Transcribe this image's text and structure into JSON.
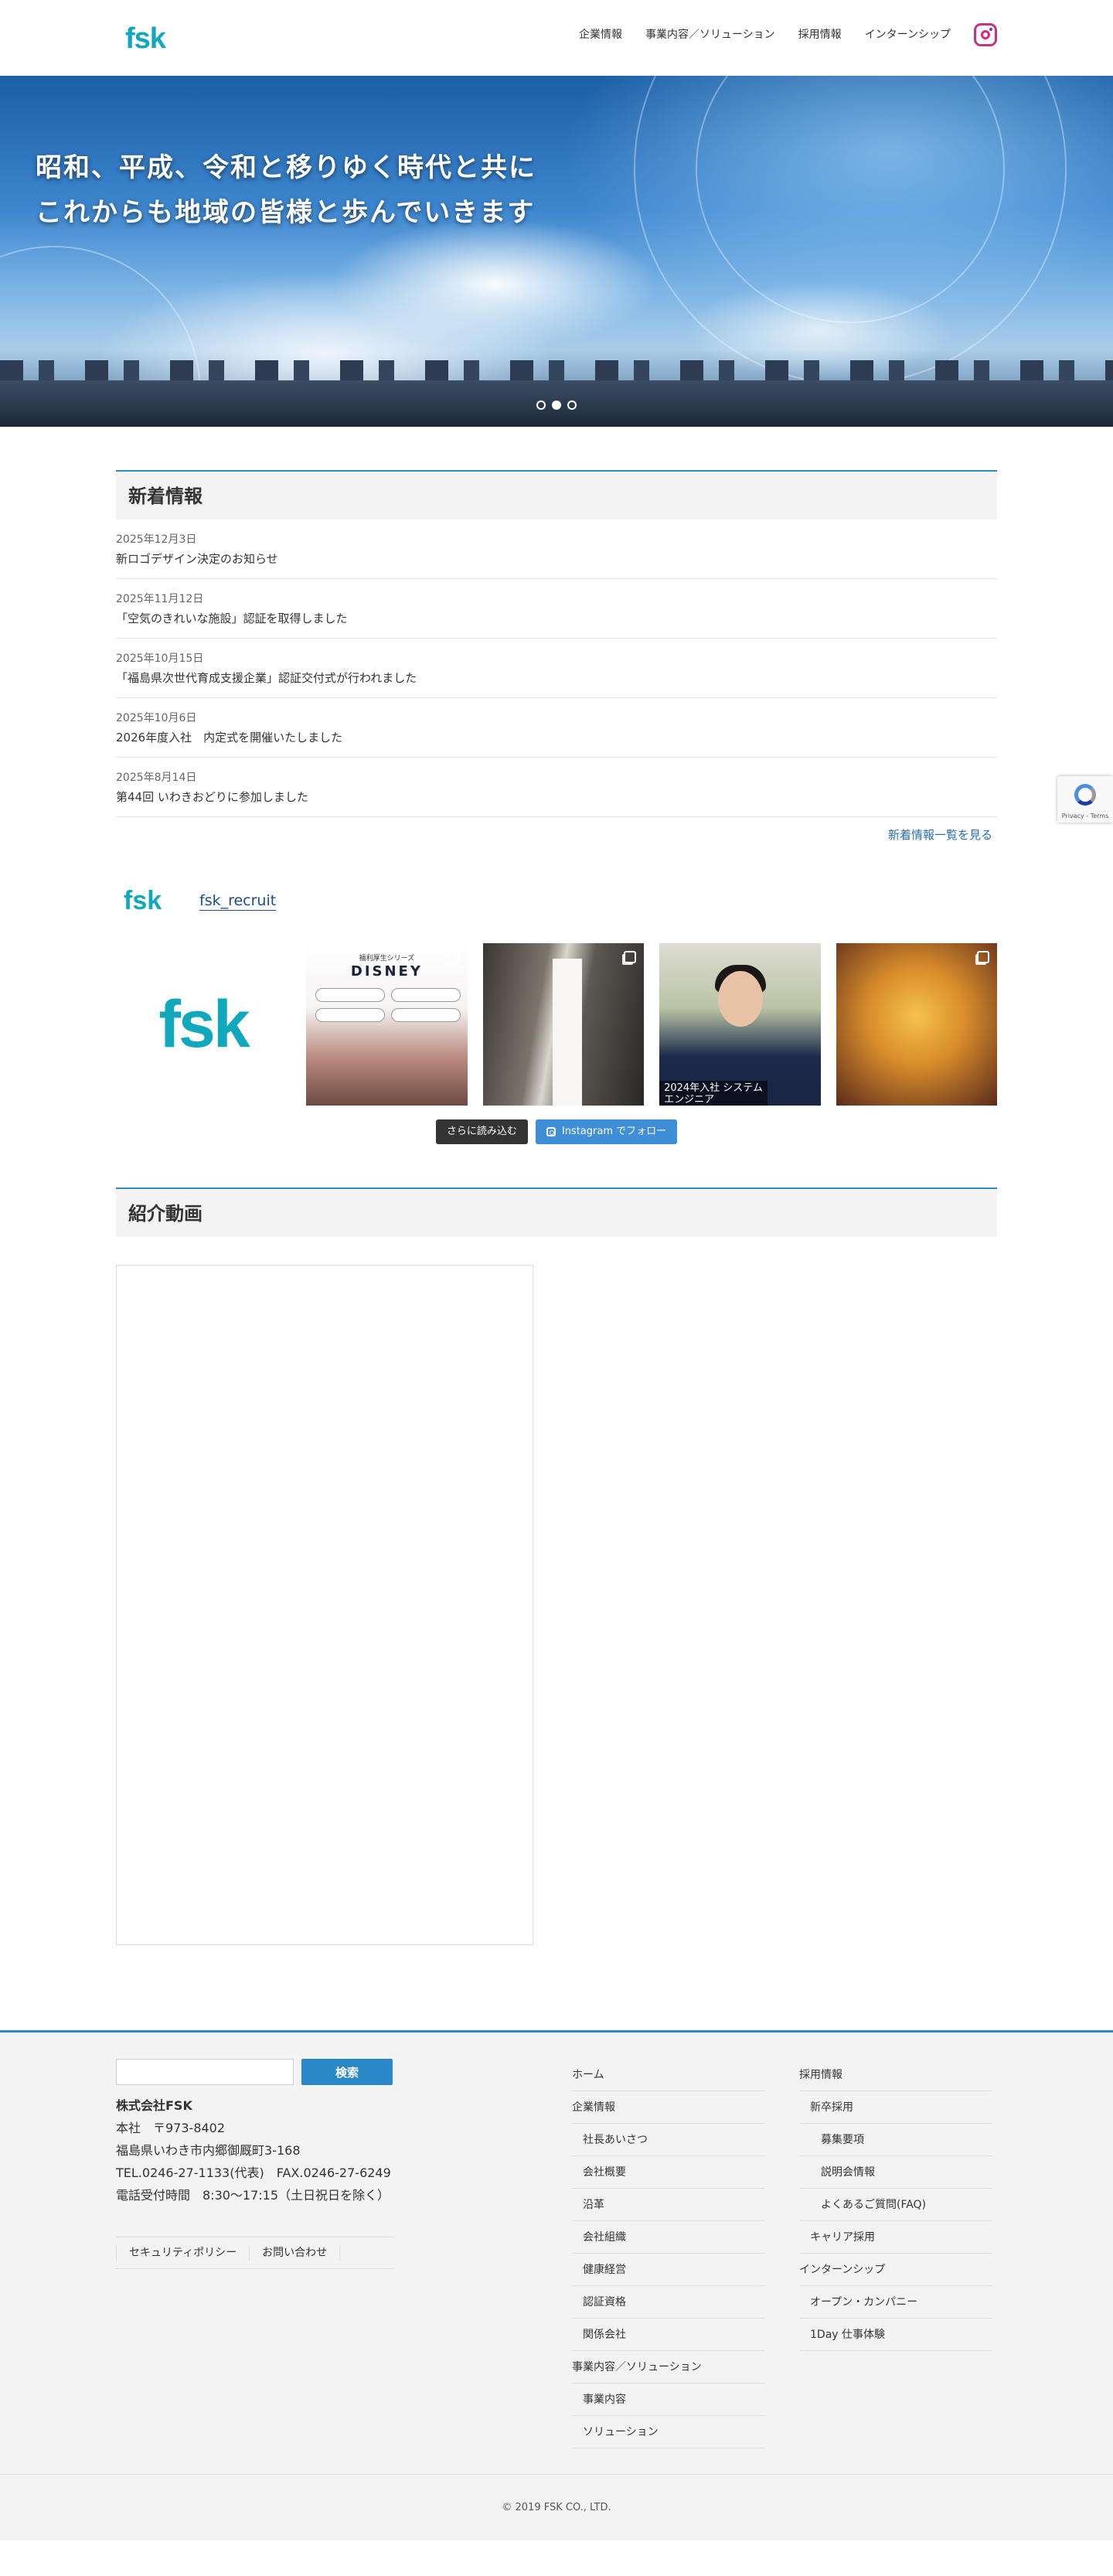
{
  "header": {
    "logo": "fsk",
    "nav": [
      "企業情報",
      "事業内容／ソリューション",
      "採用情報",
      "インターンシップ"
    ]
  },
  "hero": {
    "line1": "昭和、平成、令和と移りゆく時代と共に",
    "line2": "これからも地域の皆様と歩んでいきます",
    "slide_count": 3,
    "active_slide": 1
  },
  "news": {
    "title": "新着情報",
    "items": [
      {
        "date": "2025年12月3日",
        "title": "新ロゴデザイン決定のお知らせ"
      },
      {
        "date": "2025年11月12日",
        "title": "「空気のきれいな施設」認証を取得しました"
      },
      {
        "date": "2025年10月15日",
        "title": "「福島県次世代育成支援企業」認証交付式が行われました"
      },
      {
        "date": "2025年10月6日",
        "title": "2026年度入社　内定式を開催いたしました"
      },
      {
        "date": "2025年8月14日",
        "title": "第44回 いわきおどりに参加しました"
      }
    ],
    "more": "新着情報一覧を見る"
  },
  "instagram": {
    "avatar": "fsk",
    "username": "fsk_recruit",
    "logo": "fsk",
    "tile1_title": "福利厚生シリーズ",
    "tile1_brand": "DISNEY",
    "tile3_caption": "2024年入社 システムエンジニア",
    "load_more": "さらに読み込む",
    "follow": "Instagram でフォロー"
  },
  "video": {
    "title": "紹介動画"
  },
  "recaptcha": {
    "text": "Privacy - Terms"
  },
  "footer": {
    "search_placeholder": "",
    "search_button": "検索",
    "company": "株式会社FSK",
    "address1": "本社　〒973-8402",
    "address2": "福島県いわき市内郷御厩町3-168",
    "tel": "TEL.0246-27-1133(代表)　FAX.0246-27-6249",
    "hours": "電話受付時間　8:30〜17:15（土日祝日を除く）",
    "links": [
      "セキュリティポリシー",
      "お問い合わせ"
    ],
    "menu1": [
      {
        "label": "ホーム",
        "level": 1
      },
      {
        "label": "企業情報",
        "level": 1
      },
      {
        "label": "社長あいさつ",
        "level": 2
      },
      {
        "label": "会社概要",
        "level": 2
      },
      {
        "label": "沿革",
        "level": 2
      },
      {
        "label": "会社組織",
        "level": 2
      },
      {
        "label": "健康経営",
        "level": 2
      },
      {
        "label": "認証資格",
        "level": 2
      },
      {
        "label": "関係会社",
        "level": 2
      },
      {
        "label": "事業内容／ソリューション",
        "level": 1
      },
      {
        "label": "事業内容",
        "level": 2
      },
      {
        "label": "ソリューション",
        "level": 2
      }
    ],
    "menu2": [
      {
        "label": "採用情報",
        "level": 1
      },
      {
        "label": "新卒採用",
        "level": 2
      },
      {
        "label": "募集要項",
        "level": 3
      },
      {
        "label": "説明会情報",
        "level": 3
      },
      {
        "label": "よくあるご質問(FAQ)",
        "level": 3
      },
      {
        "label": "キャリア採用",
        "level": 2
      },
      {
        "label": "インターンシップ",
        "level": 1
      },
      {
        "label": "オープン・カンパニー",
        "level": 2
      },
      {
        "label": "1Day 仕事体験",
        "level": 2
      }
    ],
    "copyright": "© 2019 FSK CO., LTD."
  }
}
